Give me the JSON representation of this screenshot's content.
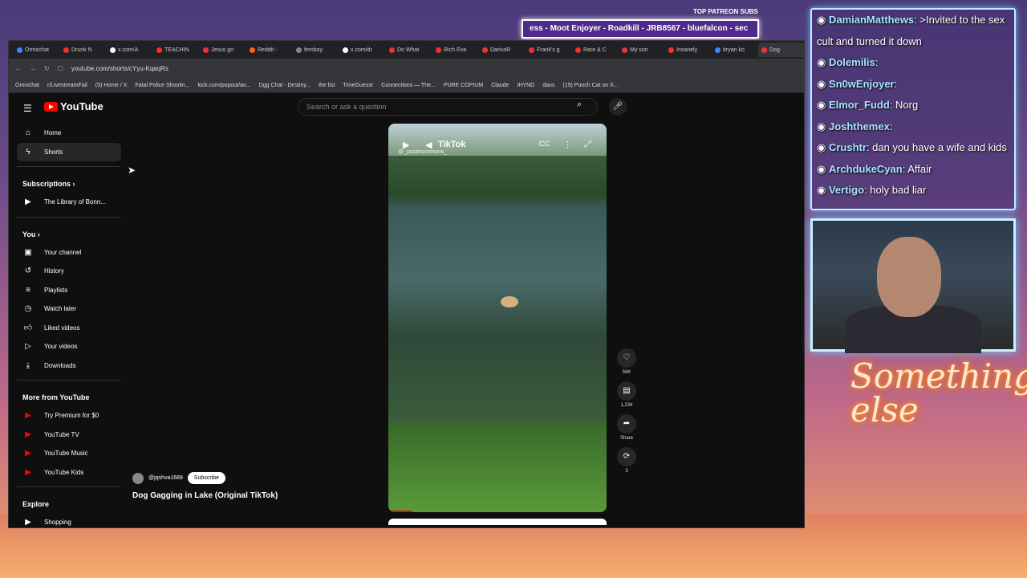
{
  "overlay": {
    "patreon_label": "TOP PATREON SUBS",
    "patreon_ticker": "ess - Moot Enjoyer - Roadkill - JRB8567 - bluefalcon - sec",
    "chat": [
      {
        "user": "DamianMatthews",
        "text": ">Invited to the sex cult and turned it down"
      },
      {
        "user": "Dolemilis",
        "text": ""
      },
      {
        "user": "Sn0wEnjoyer",
        "text": ""
      },
      {
        "user": "Elmor_Fudd",
        "text": "Norg"
      },
      {
        "user": "Joshthemex",
        "text": ""
      },
      {
        "user": "Crushtr",
        "text": "dan you have a wife and kids"
      },
      {
        "user": "ArchdukeCyan",
        "text": "Affair"
      },
      {
        "user": "Vertigo",
        "text": "holy bad liar"
      }
    ],
    "neon_sign": "Something else"
  },
  "browser": {
    "tabs": [
      "Omnichat",
      "Drunk N",
      "x.com/A",
      "TEACHIN",
      "Jesus go",
      "Reddit -",
      "femboy.",
      "x.com/dr",
      "Do What",
      "Rich Eva",
      "DariusR",
      "Frank's g",
      "Rare & C",
      "My son",
      "Insanely",
      "bryan ko",
      "Dog"
    ],
    "url": "youtube.com/shorts/cYyu-KqaqRs",
    "bookmarks": [
      "Omnichat",
      "r/LivestreamFail",
      "(5) Home / X",
      "Fatal Police Shootin...",
      "kick.com/popout/an...",
      "Dgg Chat - Destiny...",
      "the list",
      "TimeGuessr",
      "Connections — The...",
      "PURE COPIUM",
      "Claude",
      "IHYND",
      "dans",
      "(19) Punch Cat on X..."
    ]
  },
  "youtube": {
    "logo": "YouTube",
    "search_placeholder": "Search or ask a question",
    "nav_main": [
      {
        "icon": "home-icon",
        "label": "Home"
      },
      {
        "icon": "shorts-icon",
        "label": "Shorts"
      }
    ],
    "subscriptions_title": "Subscriptions",
    "subscriptions": [
      "The Library of Bonn..."
    ],
    "you_title": "You",
    "you_items": [
      {
        "icon": "channel-icon",
        "label": "Your channel"
      },
      {
        "icon": "history-icon",
        "label": "History"
      },
      {
        "icon": "playlists-icon",
        "label": "Playlists"
      },
      {
        "icon": "watch-later-icon",
        "label": "Watch later"
      },
      {
        "icon": "liked-icon",
        "label": "Liked videos"
      },
      {
        "icon": "your-videos-icon",
        "label": "Your videos"
      },
      {
        "icon": "downloads-icon",
        "label": "Downloads"
      }
    ],
    "more_title": "More from YouTube",
    "more_items": [
      "Try Premium for $0",
      "YouTube TV",
      "YouTube Music",
      "YouTube Kids"
    ],
    "explore_title": "Explore",
    "explore_items": [
      "Shopping"
    ],
    "short": {
      "overlay_user": "@_josiahsimmons_",
      "overlay_brand": "TikTok",
      "channel": "@jqshva1689",
      "subscribe": "Subscribe",
      "title": "Dog Gagging in Lake (Original TikTok)",
      "likes": "56K",
      "comments": "1,234",
      "share": "Share",
      "remix": "3"
    }
  },
  "colors": {
    "accent": "#ff0000",
    "chat_user": "#a6e6ff",
    "bg": "#0f0f0f"
  }
}
